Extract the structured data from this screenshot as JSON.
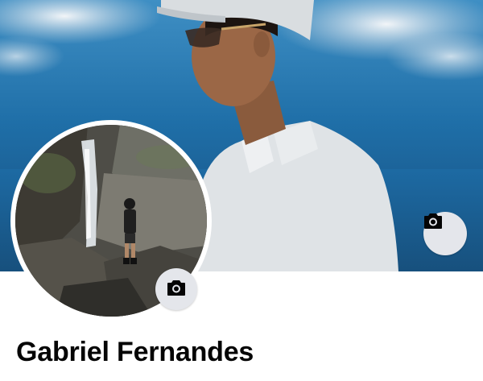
{
  "profile": {
    "name": "Gabriel Fernandes"
  },
  "icons": {
    "cover_camera": "camera-icon",
    "avatar_camera": "camera-icon"
  },
  "colors": {
    "sky_blue": "#2a7bb8",
    "button_bg": "#e4e6eb",
    "name_text": "#050505"
  }
}
